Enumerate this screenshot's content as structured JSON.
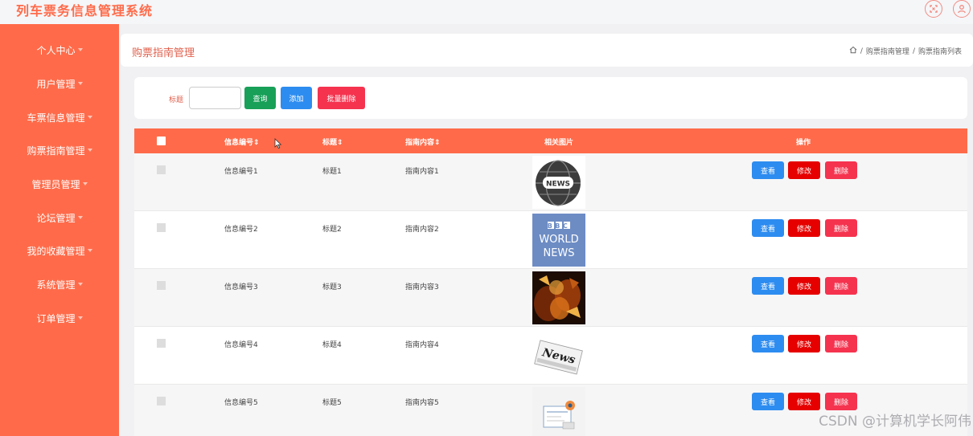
{
  "app": {
    "title": "列车票务信息管理系统"
  },
  "top_icons": [
    "fullscreen-icon",
    "user-icon"
  ],
  "sidebar": {
    "items": [
      {
        "label": "个人中心"
      },
      {
        "label": "用户管理"
      },
      {
        "label": "车票信息管理"
      },
      {
        "label": "购票指南管理"
      },
      {
        "label": "管理员管理"
      },
      {
        "label": "论坛管理"
      },
      {
        "label": "我的收藏管理"
      },
      {
        "label": "系统管理"
      },
      {
        "label": "订单管理"
      }
    ]
  },
  "header": {
    "title": "购票指南管理",
    "breadcrumb": [
      "购票指南管理",
      "购票指南列表"
    ],
    "separator": "/"
  },
  "search": {
    "label": "标题",
    "placeholder": "",
    "query_button": "查询",
    "add_button": "添加",
    "batch_delete_button": "批量删除"
  },
  "table": {
    "columns": [
      "信息编号",
      "标题",
      "指南内容",
      "相关图片",
      "操作"
    ],
    "sort_marker": "⇕",
    "rows": [
      {
        "id": "信息编号1",
        "title": "标题1",
        "content": "指南内容1",
        "image": "news-globe"
      },
      {
        "id": "信息编号2",
        "title": "标题2",
        "content": "指南内容2",
        "image": "bbc-world-news"
      },
      {
        "id": "信息编号3",
        "title": "标题3",
        "content": "指南内容3",
        "image": "money-fire"
      },
      {
        "id": "信息编号4",
        "title": "标题4",
        "content": "指南内容4",
        "image": "newspaper"
      },
      {
        "id": "信息编号5",
        "title": "标题5",
        "content": "指南内容5",
        "image": "news-sketch"
      }
    ],
    "actions": {
      "view": "查看",
      "edit": "修改",
      "delete": "删除"
    },
    "image_texts": {
      "news_badge": "NEWS",
      "bbc_logo": "BBC",
      "bbc_line1": "WORLD",
      "bbc_line2": "NEWS",
      "paper": "News"
    }
  },
  "colors": {
    "accent": "#ff6b4a",
    "query": "#18a058",
    "add": "#2d8cf0",
    "delete": "#f5334f",
    "edit": "#e60000"
  },
  "watermark": "CSDN @计算机学长阿伟"
}
